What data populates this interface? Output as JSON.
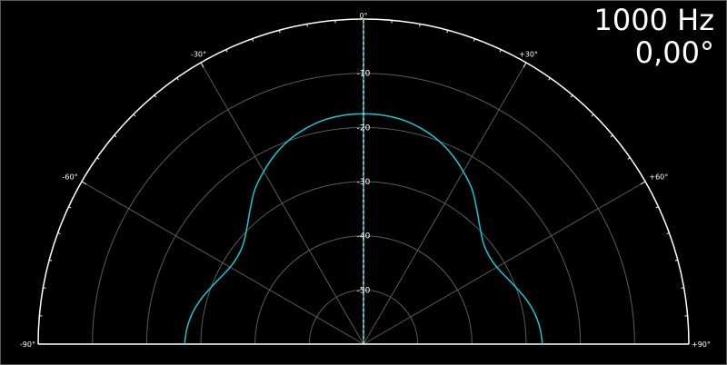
{
  "readout": {
    "frequency": "1000 Hz",
    "angle": "0,00°"
  },
  "chart_data": {
    "type": "polar",
    "angle_range": [
      -90,
      90
    ],
    "angle_ticks": [
      {
        "angle": -90,
        "label": "-90°"
      },
      {
        "angle": -60,
        "label": "-60°"
      },
      {
        "angle": -30,
        "label": "-30°"
      },
      {
        "angle": 0,
        "label": "0°"
      },
      {
        "angle": 30,
        "label": "+30°"
      },
      {
        "angle": 60,
        "label": "+60°"
      },
      {
        "angle": 90,
        "label": "+90°"
      }
    ],
    "radial_range": [
      -60,
      0
    ],
    "radial_ticks": [
      {
        "value": -10,
        "label": "-10"
      },
      {
        "value": -20,
        "label": "-20"
      },
      {
        "value": -30,
        "label": "-30"
      },
      {
        "value": -40,
        "label": "-40"
      },
      {
        "value": -50,
        "label": "-50"
      }
    ],
    "series": [
      {
        "color": "#19c6cf",
        "points": [
          {
            "angle": -90,
            "value": -27.0
          },
          {
            "angle": -85,
            "value": -27.3
          },
          {
            "angle": -80,
            "value": -27.9
          },
          {
            "angle": -75,
            "value": -28.8
          },
          {
            "angle": -70,
            "value": -29.9
          },
          {
            "angle": -65,
            "value": -30.9
          },
          {
            "angle": -60,
            "value": -31.6
          },
          {
            "angle": -55,
            "value": -31.7
          },
          {
            "angle": -50,
            "value": -31.1
          },
          {
            "angle": -45,
            "value": -29.6
          },
          {
            "angle": -40,
            "value": -27.5
          },
          {
            "angle": -35,
            "value": -25.1
          },
          {
            "angle": -30,
            "value": -23.2
          },
          {
            "angle": -25,
            "value": -21.4
          },
          {
            "angle": -20,
            "value": -19.9
          },
          {
            "angle": -15,
            "value": -18.8
          },
          {
            "angle": -10,
            "value": -18.0
          },
          {
            "angle": -5,
            "value": -17.6
          },
          {
            "angle": 0,
            "value": -17.5
          },
          {
            "angle": 5,
            "value": -17.6
          },
          {
            "angle": 10,
            "value": -18.0
          },
          {
            "angle": 15,
            "value": -18.8
          },
          {
            "angle": 20,
            "value": -19.9
          },
          {
            "angle": 25,
            "value": -21.4
          },
          {
            "angle": 30,
            "value": -23.2
          },
          {
            "angle": 35,
            "value": -25.1
          },
          {
            "angle": 40,
            "value": -27.5
          },
          {
            "angle": 45,
            "value": -29.6
          },
          {
            "angle": 50,
            "value": -31.1
          },
          {
            "angle": 55,
            "value": -31.7
          },
          {
            "angle": 60,
            "value": -31.6
          },
          {
            "angle": 65,
            "value": -30.9
          },
          {
            "angle": 70,
            "value": -29.9
          },
          {
            "angle": 75,
            "value": -28.8
          },
          {
            "angle": 80,
            "value": -27.9
          },
          {
            "angle": 85,
            "value": -27.3
          },
          {
            "angle": 90,
            "value": -27.0
          }
        ]
      }
    ],
    "grid": true,
    "colors": {
      "background": "#000000",
      "outline": "#ffffff",
      "grid": "#5a5a5a",
      "axis": "#19c6cf"
    }
  }
}
